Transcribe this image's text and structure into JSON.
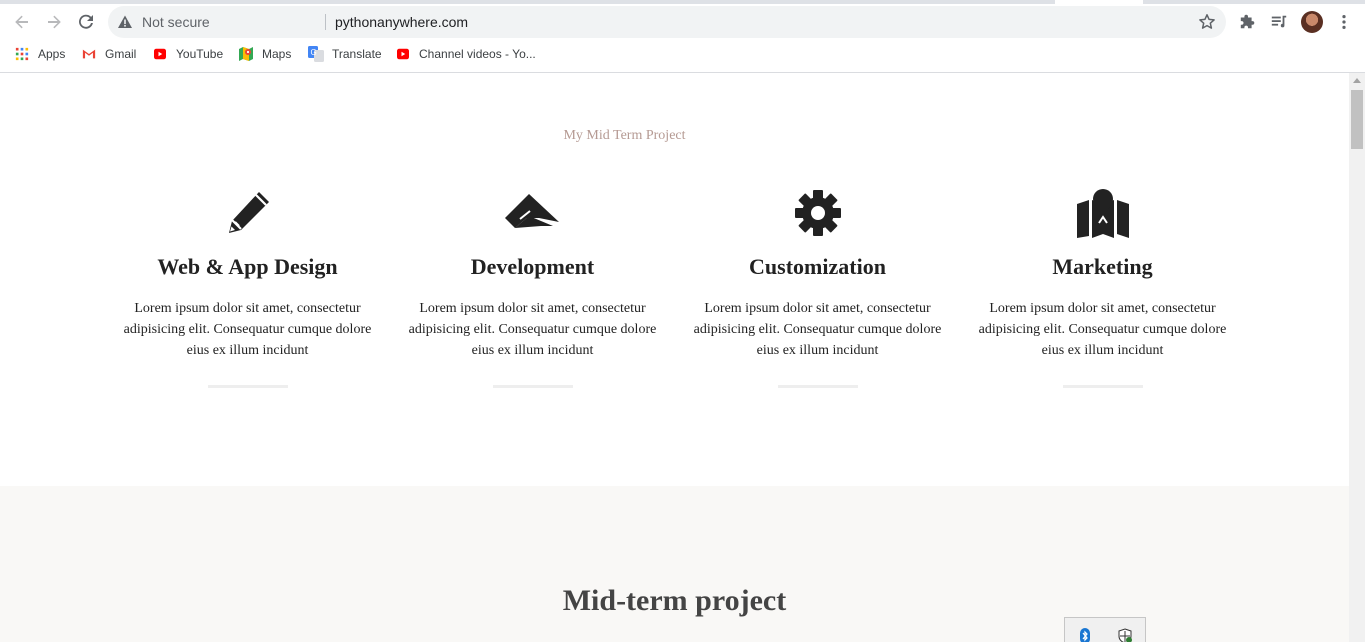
{
  "browser": {
    "security_label": "Not secure",
    "url": "pythonanywhere.com",
    "icons": [
      "back-arrow",
      "forward-arrow",
      "reload",
      "warning-triangle",
      "star",
      "puzzle-extension",
      "media-queue",
      "profile-avatar",
      "kebab-menu"
    ]
  },
  "bookmarks": [
    {
      "label": "Apps",
      "icon": "apps-grid"
    },
    {
      "label": "Gmail",
      "icon": "gmail-m"
    },
    {
      "label": "YouTube",
      "icon": "youtube-play"
    },
    {
      "label": "Maps",
      "icon": "maps-pin"
    },
    {
      "label": "Translate",
      "icon": "translate-g"
    },
    {
      "label": "Channel videos - Yo...",
      "icon": "youtube-play"
    }
  ],
  "page": {
    "subtitle": "My Mid Term Project",
    "services": [
      {
        "title": "Web & App Design",
        "text": "Lorem ipsum dolor sit amet, consectetur adipisicing elit. Consequatur cumque dolore eius ex illum incidunt",
        "icon": "pencil"
      },
      {
        "title": "Development",
        "text": "Lorem ipsum dolor sit amet, consectetur adipisicing elit. Consequatur cumque dolore eius ex illum incidunt",
        "icon": "paper-plane"
      },
      {
        "title": "Customization",
        "text": "Lorem ipsum dolor sit amet, consectetur adipisicing elit. Consequatur cumque dolore eius ex illum incidunt",
        "icon": "gear"
      },
      {
        "title": "Marketing",
        "text": "Lorem ipsum dolor sit amet, consectetur adipisicing elit. Consequatur cumque dolore eius ex illum incidunt",
        "icon": "map-pin"
      }
    ],
    "section_heading": "Mid-term project"
  },
  "colors": {
    "subtitle": "#b59a93",
    "heading": "#222222",
    "band_background": "#f9f8f6",
    "youtube_red": "#ff0000"
  }
}
